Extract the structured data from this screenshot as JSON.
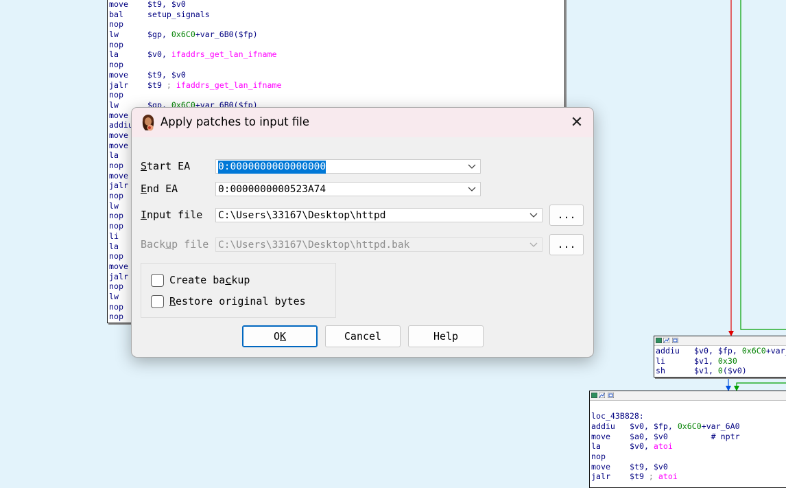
{
  "disasm_main": [
    {
      "mn": "move",
      "ops": [
        {
          "t": "$t9, $v0",
          "c": ""
        }
      ]
    },
    {
      "mn": "bal",
      "ops": [
        {
          "t": "setup_signals",
          "c": ""
        }
      ]
    },
    {
      "mn": "nop",
      "ops": []
    },
    {
      "mn": "lw",
      "ops": [
        {
          "t": "$gp, ",
          "c": ""
        },
        {
          "t": "0x6C0",
          "c": "gn"
        },
        {
          "t": "+var_6B0($fp)",
          "c": ""
        }
      ]
    },
    {
      "mn": "nop",
      "ops": []
    },
    {
      "mn": "la",
      "ops": [
        {
          "t": "$v0, ",
          "c": ""
        },
        {
          "t": "ifaddrs_get_lan_ifname",
          "c": "cm"
        }
      ]
    },
    {
      "mn": "nop",
      "ops": []
    },
    {
      "mn": "move",
      "ops": [
        {
          "t": "$t9, $v0",
          "c": ""
        }
      ]
    },
    {
      "mn": "jalr",
      "ops": [
        {
          "t": "$t9 ",
          "c": ""
        },
        {
          "t": "; ",
          "c": "gr"
        },
        {
          "t": "ifaddrs_get_lan_ifname",
          "c": "cm"
        }
      ]
    },
    {
      "mn": "nop",
      "ops": []
    },
    {
      "mn": "lw",
      "ops": [
        {
          "t": "$gp, ",
          "c": ""
        },
        {
          "t": "0x6C0",
          "c": "gn"
        },
        {
          "t": "+var_6B0($fp)",
          "c": ""
        }
      ]
    },
    {
      "mn": "move",
      "ops": []
    },
    {
      "mn": "addiu",
      "ops": []
    },
    {
      "mn": "move",
      "ops": []
    },
    {
      "mn": "move",
      "ops": []
    },
    {
      "mn": "la",
      "ops": []
    },
    {
      "mn": "nop",
      "ops": []
    },
    {
      "mn": "move",
      "ops": []
    },
    {
      "mn": "jalr",
      "ops": []
    },
    {
      "mn": "nop",
      "ops": []
    },
    {
      "mn": "lw",
      "ops": []
    },
    {
      "mn": "nop",
      "ops": []
    },
    {
      "mn": "nop",
      "ops": []
    },
    {
      "mn": "li",
      "ops": []
    },
    {
      "mn": "la",
      "ops": []
    },
    {
      "mn": "nop",
      "ops": []
    },
    {
      "mn": "move",
      "ops": []
    },
    {
      "mn": "jalr",
      "ops": []
    },
    {
      "mn": "nop",
      "ops": []
    },
    {
      "mn": "lw",
      "ops": []
    },
    {
      "mn": "nop",
      "ops": []
    },
    {
      "mn": "nop",
      "ops": []
    }
  ],
  "disasm_small": [
    {
      "mn": "addiu",
      "ops": [
        {
          "t": "$v0, $fp, ",
          "c": ""
        },
        {
          "t": "0x6C0",
          "c": "gn"
        },
        {
          "t": "+var_",
          "c": ""
        }
      ]
    },
    {
      "mn": "li",
      "ops": [
        {
          "t": "$v1, ",
          "c": ""
        },
        {
          "t": "0x30",
          "c": "gn"
        }
      ]
    },
    {
      "mn": "sh",
      "ops": [
        {
          "t": "$v1, ",
          "c": ""
        },
        {
          "t": "0",
          "c": "gn"
        },
        {
          "t": "($v0)",
          "c": ""
        }
      ]
    }
  ],
  "disasm_loc": {
    "label": "loc_43B828:",
    "lines": [
      {
        "mn": "addiu",
        "ops": [
          {
            "t": "$v0, $fp, ",
            "c": ""
          },
          {
            "t": "0x6C0",
            "c": "gn"
          },
          {
            "t": "+var_6A0",
            "c": ""
          }
        ]
      },
      {
        "mn": "move",
        "ops": [
          {
            "t": "$a0, $v0         ",
            "c": ""
          },
          {
            "t": "# nptr",
            "c": ""
          }
        ]
      },
      {
        "mn": "la",
        "ops": [
          {
            "t": "$v0, ",
            "c": ""
          },
          {
            "t": "atoi",
            "c": "cm"
          }
        ]
      },
      {
        "mn": "nop",
        "ops": []
      },
      {
        "mn": "move",
        "ops": [
          {
            "t": "$t9, $v0",
            "c": ""
          }
        ]
      },
      {
        "mn": "jalr",
        "ops": [
          {
            "t": "$t9 ",
            "c": ""
          },
          {
            "t": "; ",
            "c": "gr"
          },
          {
            "t": "atoi",
            "c": "cm"
          }
        ]
      }
    ]
  },
  "dialog": {
    "title": "Apply patches to input file",
    "start_ea_label": "Start EA",
    "start_ea_value": "0:0000000000000000",
    "end_ea_label": "End EA",
    "end_ea_value": "0:0000000000523A74",
    "input_file_label": "Input file",
    "input_file_value": "C:\\Users\\33167\\Desktop\\httpd",
    "backup_file_label": "Backup file",
    "backup_file_value": "C:\\Users\\33167\\Desktop\\httpd.bak",
    "browse_label": "...",
    "create_backup_label": "Create backup",
    "restore_label": "Restore original bytes",
    "ok_label": "OK",
    "cancel_label": "Cancel",
    "help_label": "Help",
    "create_backup_checked": false,
    "restore_checked": false
  },
  "colors": {
    "background": "#e3f3fb",
    "mnemonic": "#000080",
    "symbol": "#ff00ff",
    "number": "#008000",
    "edge_red": "#e00000",
    "edge_green": "#00a000",
    "edge_blue": "#0050e0",
    "accent": "#0078d7"
  }
}
